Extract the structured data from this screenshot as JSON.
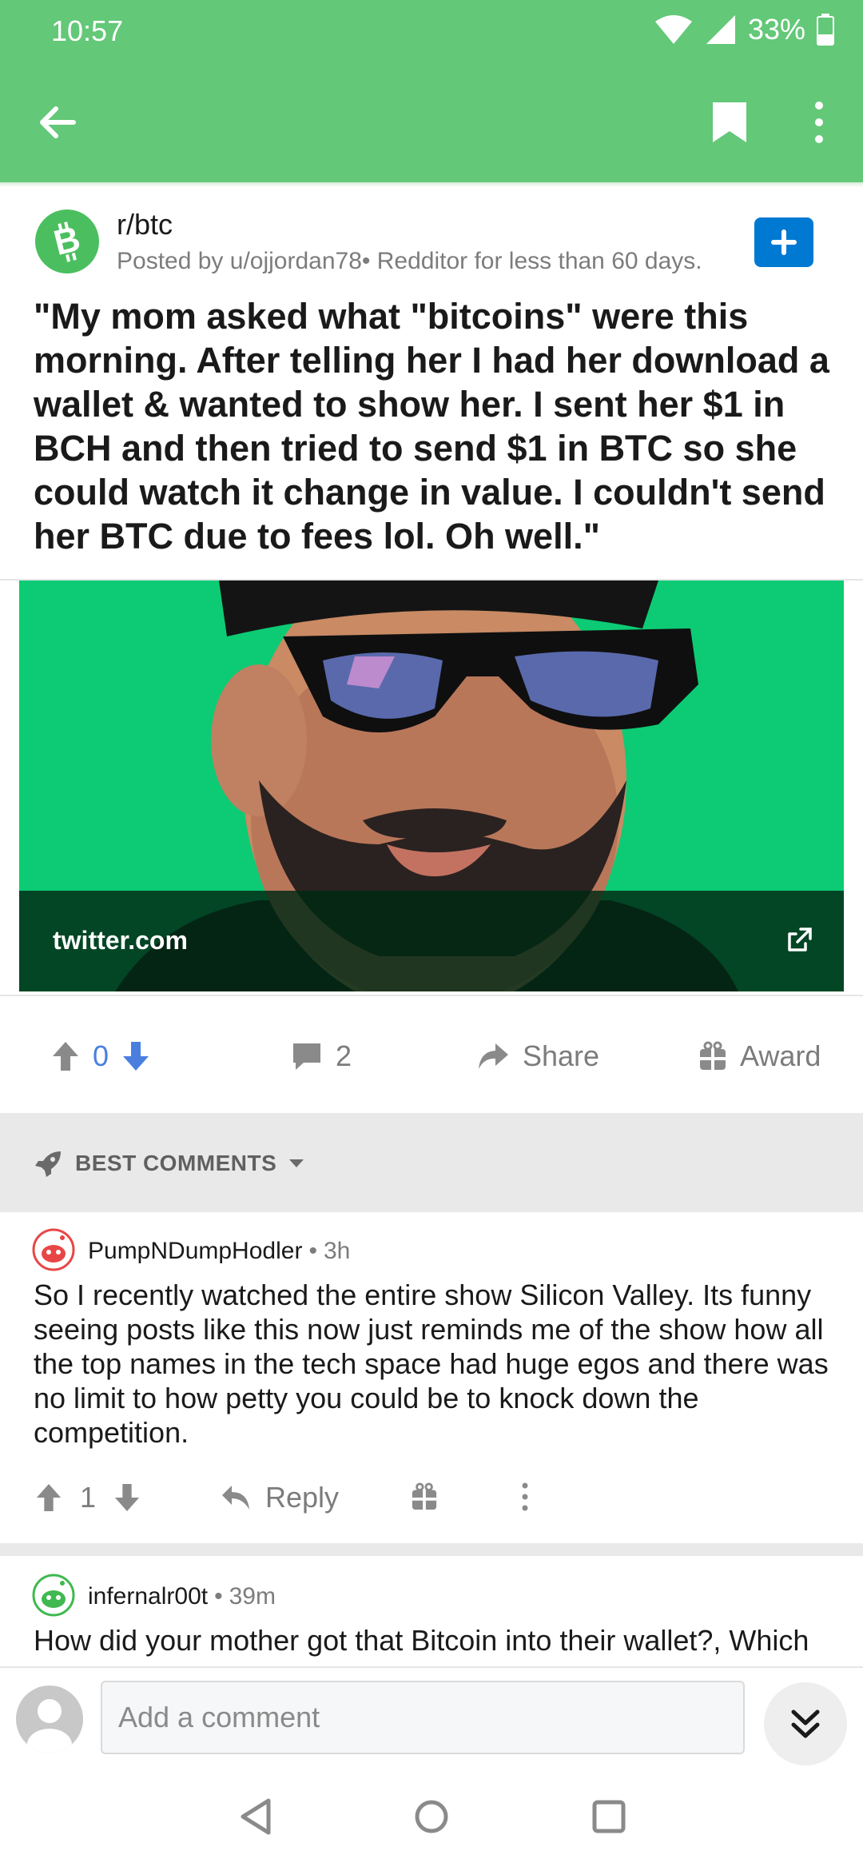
{
  "status_bar": {
    "time": "10:57",
    "battery": "33%"
  },
  "post": {
    "subreddit": "r/btc",
    "posted_by": "Posted by u/ojjordan78• Redditor for less than 60 days.",
    "title": "\"My mom asked what \"bitcoins\" were this morning. After telling her I had her download a wallet & wanted to show her. I sent her $1 in BCH and then tried to send $1 in BTC so she could watch it change in value. I couldn't send her BTC due to fees lol. Oh well.\"",
    "link_domain": "twitter.com",
    "score": "0",
    "comment_count": "2",
    "share_label": "Share",
    "award_label": "Award"
  },
  "sort": {
    "label": "BEST COMMENTS"
  },
  "comments": [
    {
      "author": "PumpNDumpHodler",
      "time": "3h",
      "body": "So I recently watched the entire show Silicon Valley.  Its funny seeing posts like this now just reminds me of the show how all the top names in the tech space had huge egos and there was no limit to how petty you could be to knock down the competition.",
      "score": "1",
      "reply_label": "Reply"
    },
    {
      "author": "infernalr00t",
      "time": "39m",
      "body": "How did your mother got that Bitcoin into their wallet?, Which"
    }
  ],
  "comment_input": {
    "placeholder": "Add a comment"
  },
  "colors": {
    "header": "#63c878",
    "accent_blue": "#0079d3",
    "upvote_blue": "#4a7fe0"
  }
}
